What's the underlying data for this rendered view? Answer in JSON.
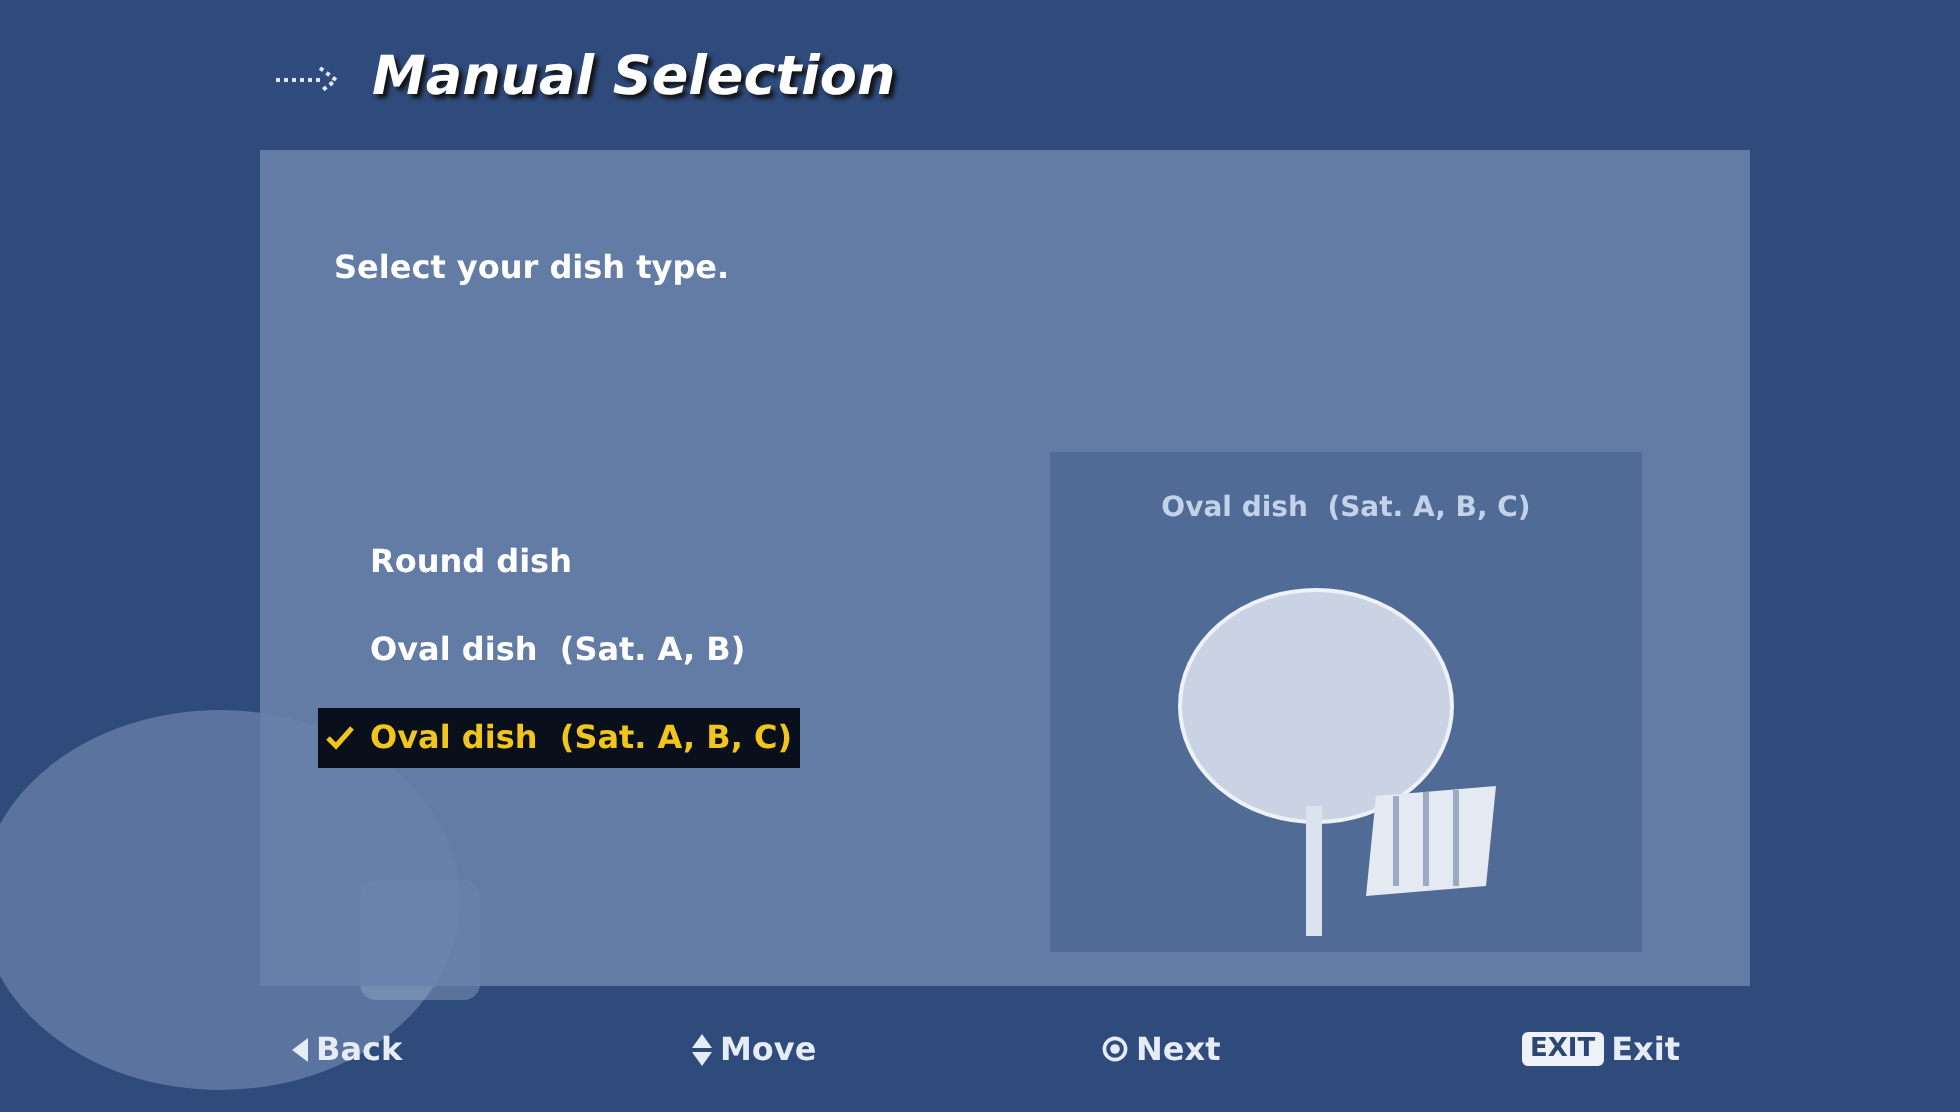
{
  "title": "Manual Selection",
  "prompt": "Select your dish type.",
  "options": [
    {
      "label": "Round dish",
      "selected": false
    },
    {
      "label": "Oval dish  (Sat. A, B)",
      "selected": false
    },
    {
      "label": "Oval dish  (Sat. A, B, C)",
      "selected": true
    }
  ],
  "preview": {
    "caption": "Oval dish  (Sat. A, B, C)"
  },
  "footer": [
    {
      "kind": "back",
      "label": "Back"
    },
    {
      "kind": "move",
      "label": "Move"
    },
    {
      "kind": "next",
      "label": "Next"
    },
    {
      "kind": "exit",
      "key": "EXIT",
      "label": "Exit"
    }
  ]
}
